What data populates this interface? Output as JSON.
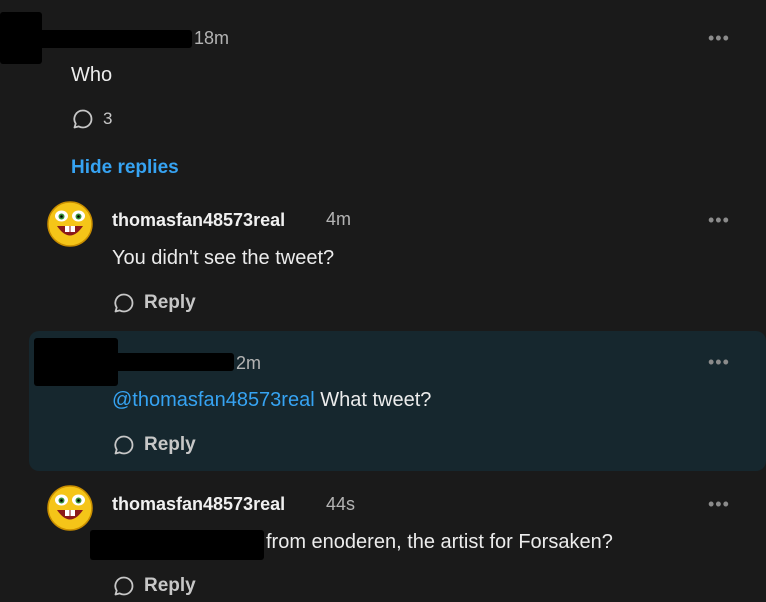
{
  "top_comment": {
    "time": "18m",
    "text": "Who",
    "reply_count": "3",
    "more": "•••",
    "hide_replies": "Hide replies"
  },
  "replies": [
    {
      "user": "thomasfan48573real",
      "time": "4m",
      "text": "You didn't see the tweet?",
      "reply": "Reply",
      "more": "•••"
    },
    {
      "time": "2m",
      "mention": "@thomasfan48573real",
      "text": " What tweet?",
      "reply": "Reply",
      "more": "•••"
    },
    {
      "user": "thomasfan48573real",
      "time": "44s",
      "text": "from enoderen, the artist for Forsaken?",
      "reply": "Reply",
      "more": "•••"
    }
  ],
  "colors": {
    "accent": "#36a3f2",
    "background": "#1a1a1a",
    "highlight": "#16272e"
  },
  "icons": {
    "avatar": "laughing-face-icon",
    "reply": "speech-bubble-icon"
  }
}
